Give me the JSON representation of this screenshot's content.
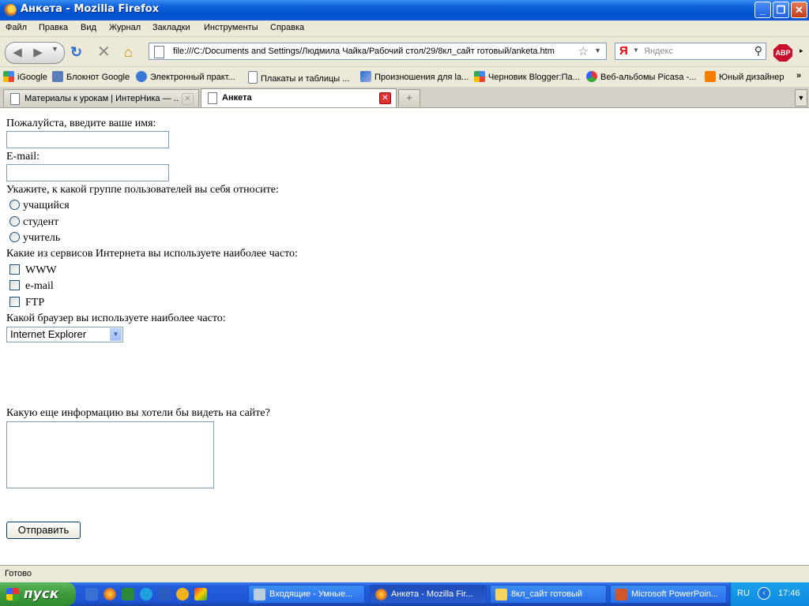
{
  "window": {
    "title": "Анкета - Mozilla Firefox",
    "minimize": "_",
    "maximize": "❐",
    "close": "✕"
  },
  "menu": [
    "Файл",
    "Правка",
    "Вид",
    "Журнал",
    "Закладки",
    "Инструменты",
    "Справка"
  ],
  "nav": {
    "url": "file:///C:/Documents and Settings/Людмила Чайка/Рабочий стол/29/8кл_сайт готовый/anketa.htm",
    "search_engine": "Я",
    "search_placeholder": "Яндекс",
    "abp": "ABP"
  },
  "bookmarks": [
    "iGoogle",
    "Блокнот Google",
    "Электронный практ...",
    "Плакаты и таблицы ...",
    "Произношения для la...",
    "Черновик Blogger:Па...",
    "Веб-альбомы Picasa -...",
    "Юный дизайнер"
  ],
  "bookmarks_more": "»",
  "tabs": [
    {
      "label": "Материалы к урокам | ИнтерНика — ...",
      "active": false
    },
    {
      "label": "Анкета",
      "active": true
    }
  ],
  "form": {
    "name_label": "Пожалуйста, введите ваше имя:",
    "name_value": "",
    "email_label": "E-mail:",
    "email_value": "",
    "group_label": "Укажите, к какой группе пользователей вы себя относите:",
    "groups": [
      "учащийся",
      "студент",
      "учитель"
    ],
    "services_label": "Какие из сервисов Интернета вы используете наиболее часто:",
    "services": [
      "WWW",
      "e-mail",
      "FTP"
    ],
    "browser_label": "Какой браузер вы используете наиболее часто:",
    "browser_selected": "Internet Explorer",
    "info_label": "Какую еще информацию вы хотели бы видеть на сайте?",
    "info_value": "",
    "submit": "Отправить"
  },
  "status": "Готово",
  "taskbar": {
    "start": "пуск",
    "tasks": [
      {
        "label": "Входящие - Умные...",
        "active": false
      },
      {
        "label": "Анкета - Mozilla Fir...",
        "active": true
      },
      {
        "label": "8кл_сайт готовый",
        "active": false
      },
      {
        "label": "Microsoft PowerPoin...",
        "active": false
      }
    ],
    "lang": "RU",
    "clock": "17:46"
  }
}
